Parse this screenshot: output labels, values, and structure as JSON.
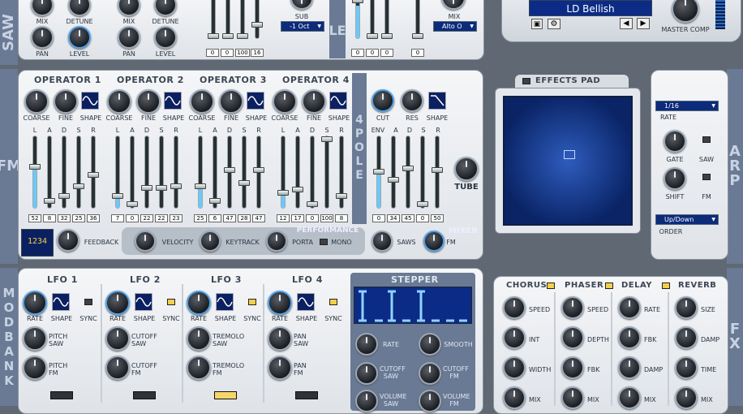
{
  "side_labels": {
    "saw": "SAW",
    "fm": "FM",
    "mod_bank": "MOD BANK",
    "arp": "ARP",
    "fx": "FX",
    "le": "LE"
  },
  "top": {
    "saw_knobs": [
      "MIX",
      "DETUNE",
      "PAN",
      "LEVEL"
    ],
    "saw2_knobs": [
      "MIX",
      "DETUNE",
      "PAN",
      "LEVEL"
    ],
    "slider_values": [
      "0",
      "0",
      "100",
      "16"
    ],
    "sub_label": "SUB",
    "sub_value": "-1 Oct",
    "right_values": [
      "0",
      "0",
      "0",
      "0"
    ],
    "mix_label": "MIX",
    "mix_value": "Alto O",
    "preset_name": "LD Bellish",
    "master_comp": "MASTER COMP"
  },
  "fm": {
    "operators": [
      {
        "title": "OPERATOR 1",
        "values": [
          "52",
          "8",
          "32",
          "25",
          "36"
        ]
      },
      {
        "title": "OPERATOR 2",
        "values": [
          "7",
          "0",
          "22",
          "22",
          "23"
        ]
      },
      {
        "title": "OPERATOR 3",
        "values": [
          "25",
          "6",
          "47",
          "28",
          "47"
        ]
      },
      {
        "title": "OPERATOR 4",
        "values": [
          "12",
          "17",
          "0",
          "100",
          "8"
        ]
      }
    ],
    "knob_labels": [
      "COARSE",
      "FINE",
      "SHAPE"
    ],
    "adsr": [
      "L",
      "A",
      "D",
      "S",
      "R"
    ],
    "filter_label": "4 POLE",
    "filter_knobs": [
      "CUT",
      "RES",
      "SHAPE"
    ],
    "filter_env": [
      "ENV",
      "A",
      "D",
      "S",
      "R"
    ],
    "filter_values": [
      "0",
      "34",
      "45",
      "0",
      "50"
    ],
    "tube": "TUBE",
    "feedback": "FEEDBACK",
    "algo": "1234",
    "performance": "PERFORMANCE",
    "mixer": "MIXER",
    "velocity": "VELOCITY",
    "keytrack": "KEYTRACK",
    "porta": "PORTA",
    "mono": "MONO",
    "saws": "SAWS",
    "fm_knob": "FM"
  },
  "effects_pad": {
    "title": "EFFECTS PAD"
  },
  "arp": {
    "rate_label": "RATE",
    "rate_value": "1/16",
    "gate": "GATE",
    "saw": "SAW",
    "shift": "SHIFT",
    "fm": "FM",
    "order_label": "ORDER",
    "order_value": "Up/Down"
  },
  "mod": {
    "lfos": [
      {
        "title": "LFO 1",
        "rate": "RATE",
        "shape": "SHAPE",
        "sync": "SYNC",
        "dest1": "PITCH\nSAW",
        "dest2": "PITCH\nFM"
      },
      {
        "title": "LFO 2",
        "rate": "RATE",
        "shape": "SHAPE",
        "sync": "SYNC",
        "dest1": "CUTOFF\nSAW",
        "dest2": "CUTOFF\nFM"
      },
      {
        "title": "LFO 3",
        "rate": "RATE",
        "shape": "SHAPE",
        "sync": "SYNC",
        "dest1": "TREMOLO\nSAW",
        "dest2": "TREMOLO\nFM"
      },
      {
        "title": "LFO 4",
        "rate": "RATE",
        "shape": "SHAPE",
        "sync": "SYNC",
        "dest1": "PAN\nSAW",
        "dest2": "PAN\nFM"
      }
    ],
    "stepper": {
      "title": "STEPPER",
      "k1": "RATE",
      "k2": "SMOOTH",
      "k3": "CUTOFF\nSAW",
      "k4": "CUTOFF\nFM",
      "k5": "VOLUME\nSAW",
      "k6": "VOLUME\nFM"
    }
  },
  "fx": {
    "sections": [
      {
        "title": "CHORUS",
        "knobs": [
          "SPEED",
          "INT",
          "WIDTH",
          "MIX"
        ]
      },
      {
        "title": "PHASER",
        "knobs": [
          "SPEED",
          "DEPTH",
          "FBK",
          "MIX"
        ]
      },
      {
        "title": "DELAY",
        "knobs": [
          "RATE",
          "FBK",
          "DAMP",
          "MIX"
        ]
      },
      {
        "title": "REVERB",
        "knobs": [
          "SIZE",
          "DAMP",
          "TIME",
          "MIX"
        ]
      }
    ]
  }
}
